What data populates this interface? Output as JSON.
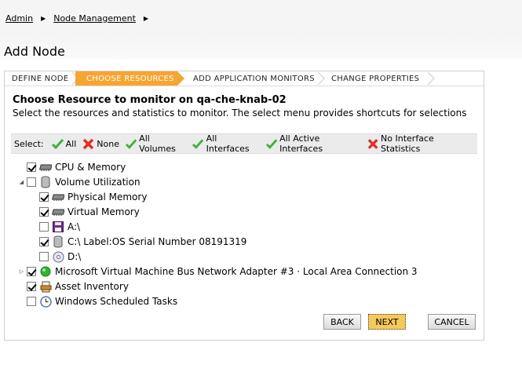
{
  "breadcrumb": {
    "items": [
      "Admin",
      "Node Management"
    ]
  },
  "page_title": "Add Node",
  "wizard": {
    "steps": [
      "DEFINE NODE",
      "CHOOSE RESOURCES",
      "ADD APPLICATION MONITORS",
      "CHANGE PROPERTIES"
    ],
    "active_step": "CHOOSE RESOURCES"
  },
  "content": {
    "heading": "Choose Resource to monitor on qa-che-knab-02",
    "description": "Select the resources and statistics to monitor. The select menu provides shortcuts for selections"
  },
  "select_bar": {
    "label": "Select:",
    "options": [
      {
        "label": "All",
        "icon": "check-icon"
      },
      {
        "label": "None",
        "icon": "x-icon"
      },
      {
        "label": "All Volumes",
        "icon": "check-icon"
      },
      {
        "label": "All Interfaces",
        "icon": "check-icon"
      },
      {
        "label": "All Active Interfaces",
        "icon": "check-icon"
      },
      {
        "label": "No Interface Statistics",
        "icon": "x-icon"
      }
    ]
  },
  "tree": [
    {
      "label": "CPU & Memory",
      "checked": true,
      "icon": "memory-chip-icon"
    },
    {
      "label": "Volume Utilization",
      "checked": false,
      "icon": "disk-cylinder-icon",
      "expanded": true
    },
    {
      "label": "Physical Memory",
      "checked": true,
      "icon": "memory-chip-icon"
    },
    {
      "label": "Virtual Memory",
      "checked": true,
      "icon": "memory-chip-icon"
    },
    {
      "label": "A:\\",
      "checked": false,
      "icon": "floppy-disk-icon"
    },
    {
      "label": "C:\\ Label:OS Serial Number 08191319",
      "checked": true,
      "icon": "disk-cylinder-icon"
    },
    {
      "label": "D:\\",
      "checked": false,
      "icon": "cd-rom-icon"
    },
    {
      "label": "Microsoft Virtual Machine Bus Network Adapter #3 · Local Area Connection 3",
      "checked": true,
      "icon": "network-status-green-icon",
      "expanded": false
    },
    {
      "label": "Asset Inventory",
      "checked": true,
      "icon": "asset-inventory-icon"
    },
    {
      "label": "Windows Scheduled Tasks",
      "checked": false,
      "icon": "clock-icon"
    }
  ],
  "buttons": {
    "back": "BACK",
    "next": "NEXT",
    "cancel": "CANCEL"
  },
  "colors": {
    "accent": "#f7a531",
    "check_green": "#3cb23c",
    "x_red": "#d9302c",
    "next_button": "#f6c95c"
  }
}
